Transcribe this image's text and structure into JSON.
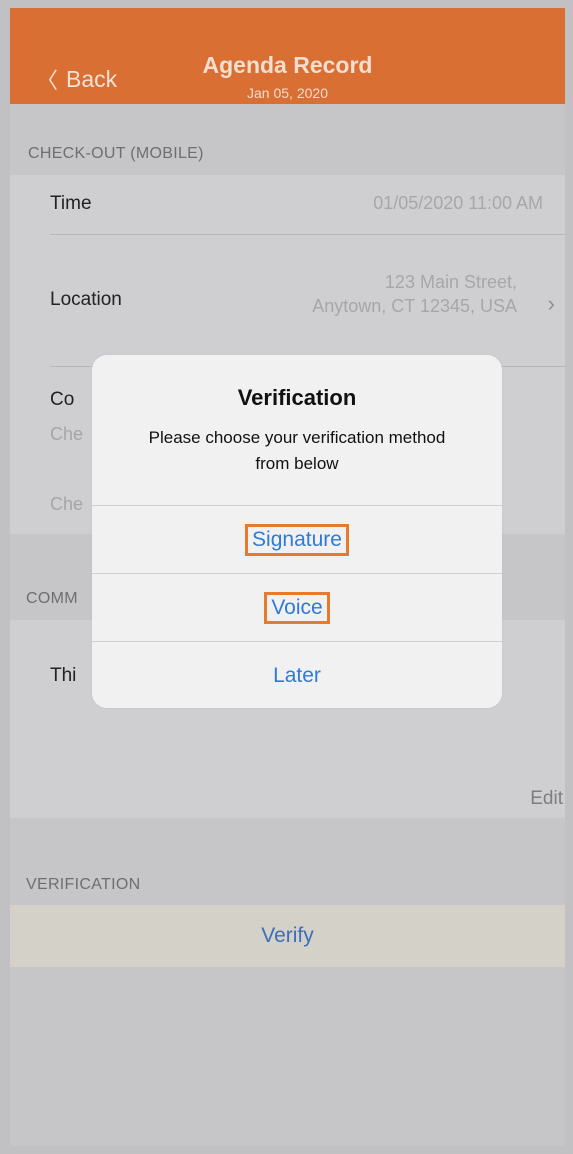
{
  "nav": {
    "back_label": "Back",
    "title": "Agenda Record",
    "subtitle": "Jan 05, 2020",
    "color": "#d96f32"
  },
  "checkout": {
    "section_title": "CHECK-OUT (MOBILE)",
    "time_label": "Time",
    "time_value": "01/05/2020 11:00 AM",
    "location_label": "Location",
    "location_line1": "123 Main Street,",
    "location_line2": "Anytown, CT 12345, USA",
    "partial_label": "Co",
    "partial_line1": "Che",
    "partial_line2": "Che"
  },
  "comments": {
    "section_title_partial": "COMM",
    "text_partial": "Thi",
    "edit_label": "Edit"
  },
  "verification": {
    "section_title": "VERIFICATION",
    "verify_label": "Verify"
  },
  "modal": {
    "title": "Verification",
    "message": "Please choose your verification method from below",
    "options": [
      "Signature",
      "Voice",
      "Later"
    ],
    "button_color": "#2f7ad9",
    "highlight_color": "#e57b2c"
  }
}
